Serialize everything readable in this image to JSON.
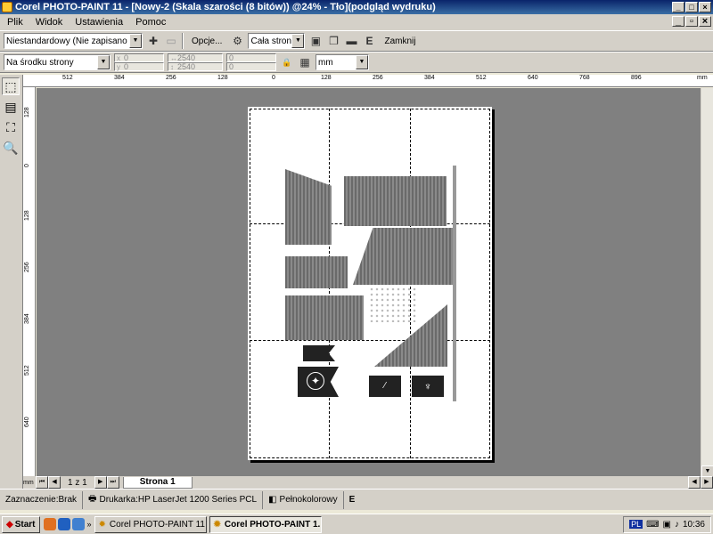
{
  "window": {
    "title": "Corel PHOTO-PAINT 11 - [Nowy-2 (Skala szarości (8 bitów)) @24% - Tło](podgląd wydruku)",
    "controls": [
      "_",
      "□",
      "×"
    ],
    "mdi_controls": [
      "_",
      "▫",
      "×"
    ]
  },
  "menu": {
    "items": [
      "Plik",
      "Widok",
      "Ustawienia",
      "Pomoc"
    ]
  },
  "toolbar1": {
    "preset": "Niestandardowy (Nie zapisano usta...",
    "options_label": "Opcje...",
    "print_range": "Cała strona",
    "e_label": "E",
    "close_label": "Zamknij"
  },
  "toolbar2": {
    "position": "Na środku strony",
    "x_value": "0",
    "y_value": "0",
    "x_label": "x",
    "y_label": "y",
    "width_value": "2540",
    "height_value": "2540",
    "scale_x_value": "0",
    "scale_y_value": "0",
    "units": "mm"
  },
  "ruler": {
    "horizontal_ticks": [
      "512",
      "384",
      "256",
      "128",
      "0",
      "128",
      "256",
      "384",
      "512",
      "640",
      "768",
      "896"
    ],
    "vertical_ticks": [
      "128",
      "0",
      "128",
      "256",
      "384",
      "512",
      "640"
    ],
    "corner_unit": "%",
    "unit_label": "mm"
  },
  "page_nav": {
    "counter": "1 z 1",
    "tab": "Strona 1"
  },
  "status": {
    "selection": "Zaznaczenie:Brak",
    "printer": "Drukarka:HP LaserJet 1200 Series PCL",
    "color_mode": "Pełnokolorowy",
    "e_label": "E"
  },
  "taskbar": {
    "start": "Start",
    "tasks": [
      "Corel PHOTO-PAINT 11",
      "Corel PHOTO-PAINT 1..."
    ],
    "language": "PL",
    "time": "10:36"
  }
}
